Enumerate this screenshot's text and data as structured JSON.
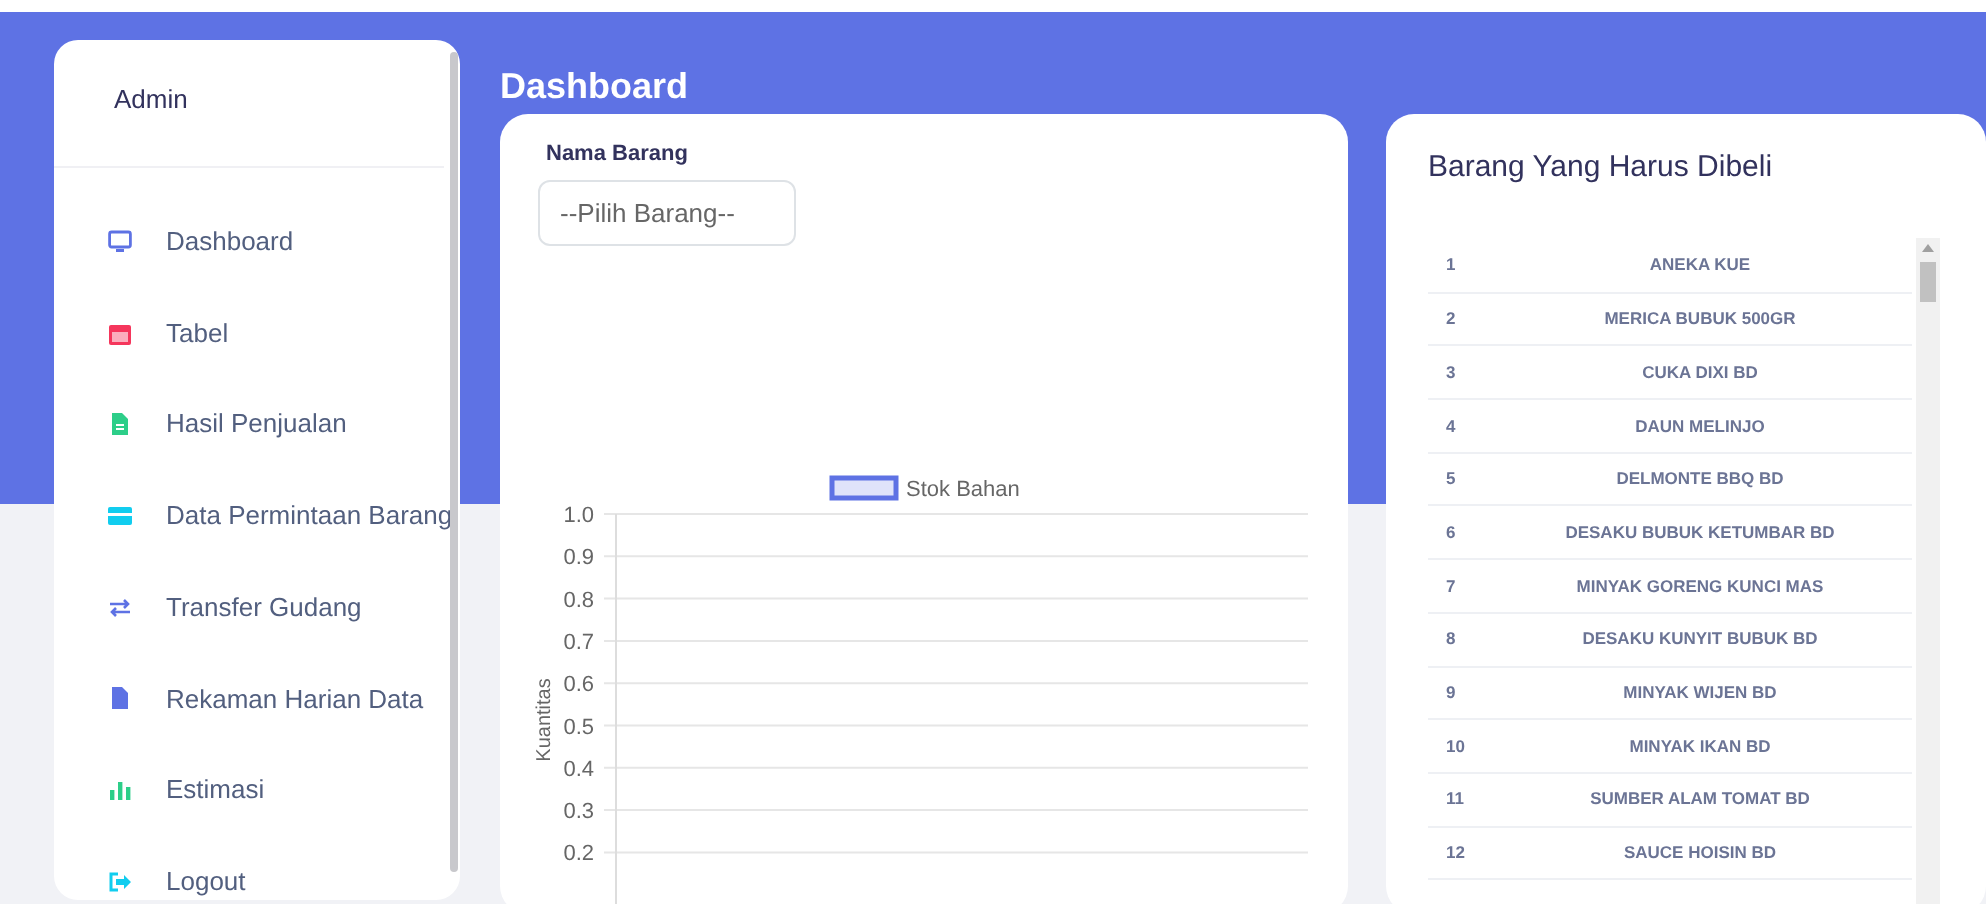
{
  "sidebar": {
    "user": "Admin",
    "items": [
      {
        "label": "Dashboard"
      },
      {
        "label": "Tabel"
      },
      {
        "label": "Hasil Penjualan"
      },
      {
        "label": "Data Permintaan Barang"
      },
      {
        "label": "Transfer Gudang"
      },
      {
        "label": "Rekaman Harian Data"
      },
      {
        "label": "Estimasi"
      },
      {
        "label": "Logout"
      }
    ]
  },
  "page_title": "Dashboard",
  "stock_card": {
    "field_label": "Nama Barang",
    "select": {
      "value": "--Pilih Barang--"
    },
    "chart_data": {
      "type": "bar",
      "ylabel": "Kuantitas",
      "series": [
        {
          "name": "Stok Bahan",
          "color": "#5e72e4"
        }
      ],
      "ylim": [
        0,
        1
      ],
      "grid": true,
      "yticks": [
        {
          "value": 1,
          "label": "1.0"
        },
        {
          "value": 0.9,
          "label": "0.9"
        },
        {
          "value": 0.8,
          "label": "0.8"
        },
        {
          "value": 0.7,
          "label": "0.7"
        },
        {
          "value": 0.6,
          "label": "0.6"
        },
        {
          "value": 0.5,
          "label": "0.5"
        },
        {
          "value": 0.4,
          "label": "0.4"
        },
        {
          "value": 0.3,
          "label": "0.3"
        },
        {
          "value": 0.2,
          "label": "0.2"
        }
      ]
    }
  },
  "purchase_card": {
    "title": "Barang Yang Harus Dibeli",
    "rows": [
      {
        "no": "1",
        "name": "ANEKA KUE"
      },
      {
        "no": "2",
        "name": "MERICA BUBUK 500GR"
      },
      {
        "no": "3",
        "name": "CUKA DIXI BD"
      },
      {
        "no": "4",
        "name": "DAUN MELINJO"
      },
      {
        "no": "5",
        "name": "DELMONTE BBQ BD"
      },
      {
        "no": "6",
        "name": "DESAKU BUBUK KETUMBAR BD"
      },
      {
        "no": "7",
        "name": "MINYAK GORENG KUNCI MAS"
      },
      {
        "no": "8",
        "name": "DESAKU KUNYIT BUBUK BD"
      },
      {
        "no": "9",
        "name": "MINYAK WIJEN BD"
      },
      {
        "no": "10",
        "name": "MINYAK IKAN BD"
      },
      {
        "no": "11",
        "name": "SUMBER ALAM TOMAT BD"
      },
      {
        "no": "12",
        "name": "SAUCE HOISIN BD"
      }
    ]
  }
}
